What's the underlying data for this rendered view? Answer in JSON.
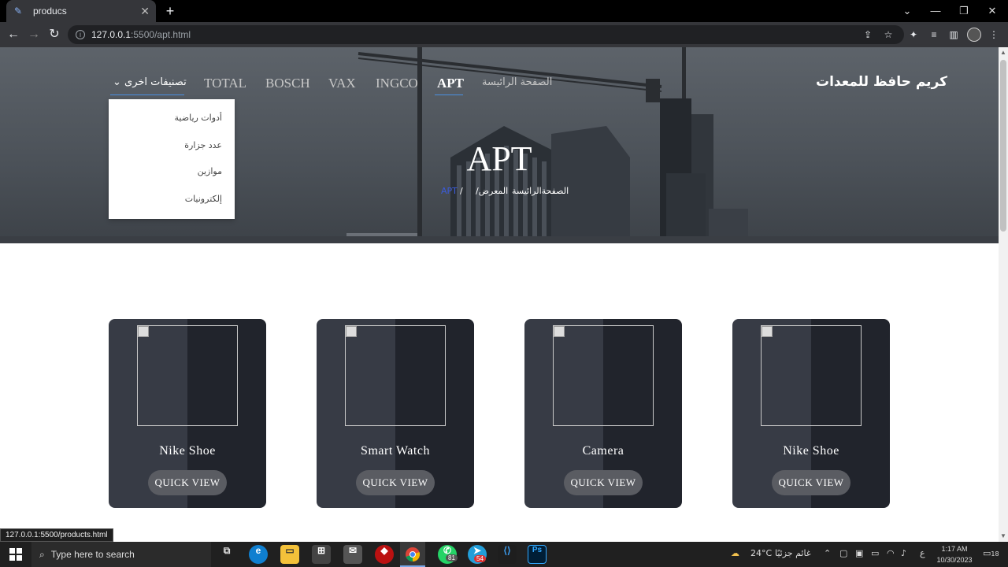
{
  "browser": {
    "tab_title": "producs",
    "url_host": "127.0.0.1",
    "url_path": ":5500/apt.html",
    "tab_close": "✕",
    "new_tab": "+"
  },
  "site": {
    "brand": "كريم حافظ للمعدات",
    "nav": [
      {
        "label": "الصفحة الرائيسة"
      },
      {
        "label": "APT"
      },
      {
        "label": "INGCO"
      },
      {
        "label": "VAX"
      },
      {
        "label": "BOSCH"
      },
      {
        "label": "TOTAL"
      },
      {
        "label": "تصنيفات اخرى"
      }
    ],
    "dropdown": [
      "أدوات رياضية",
      "عدد جزارة",
      "موازين",
      "إلكترونيات"
    ],
    "hero_title": "APT",
    "breadcrumb": {
      "home": "الصفحةالرائيسة",
      "gallery": "/المعرض",
      "sep": "/",
      "current": "APT"
    }
  },
  "products": [
    {
      "name": "Nike Shoe",
      "button": "QUICK VIEW"
    },
    {
      "name": "Smart Watch",
      "button": "QUICK VIEW"
    },
    {
      "name": "Camera",
      "button": "QUICK VIEW"
    },
    {
      "name": "Nike Shoe",
      "button": "QUICK VIEW"
    }
  ],
  "status_link": "127.0.0.1:5500/products.html",
  "taskbar": {
    "search_placeholder": "Type here to search",
    "weather": "24°C",
    "weather_text": "غائم جزئيًا",
    "lang": "ع",
    "time": "1:17 AM",
    "date": "10/30/2023",
    "notif_count": "18",
    "whatsapp_badge": "81",
    "telegram_badge": "54"
  }
}
